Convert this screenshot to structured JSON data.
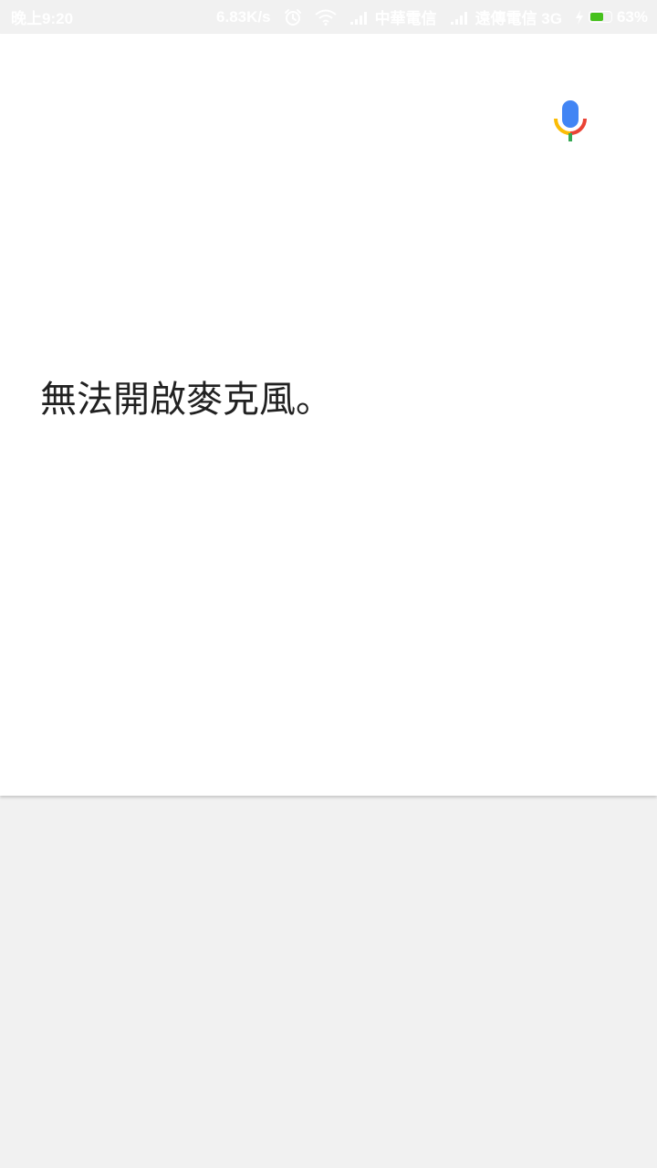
{
  "status_bar": {
    "time": "晚上9:20",
    "net_speed": "6.83K/s",
    "carrier_1": "中華電信",
    "carrier_2": "遠傳電信 3G",
    "battery_percent": "63%",
    "battery_level": 0.63,
    "battery_color": "#46c11c",
    "icons": [
      "alarm-icon",
      "wifi-icon",
      "signal-icon",
      "signal-icon",
      "charging-icon",
      "battery-icon"
    ]
  },
  "voice_search": {
    "mic_icon": "microphone-icon",
    "mic_colors": {
      "capsule": "#4285f4",
      "arc_left": "#fbbc05",
      "arc_right": "#ea4335",
      "stem": "#34a853"
    },
    "message": "無法開啟麥克風。"
  }
}
